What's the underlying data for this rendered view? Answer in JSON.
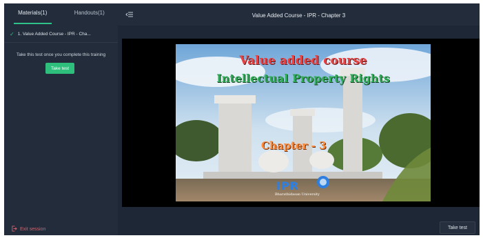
{
  "sidebar": {
    "tabs": [
      {
        "label": "Materials(1)",
        "active": true
      },
      {
        "label": "Handouts(1)",
        "active": false
      }
    ],
    "materials": [
      {
        "label": "1. Value Added Course - IPR - Cha...",
        "completed": true
      }
    ],
    "test_note": "Take this test once you complete this training",
    "take_test_label": "Take test",
    "exit_label": "Exit session"
  },
  "header": {
    "title": "Value Added Course - IPR - Chapter 3"
  },
  "slide": {
    "title_line1": "Value added course",
    "title_line2": "Intellectual Property Rights",
    "chapter": "Chapter - 3",
    "logo_text": "IPR",
    "logo_sub": "Bharathidasan University"
  },
  "footer": {
    "take_test_label": "Take test"
  },
  "colors": {
    "accent": "#2fbf7d",
    "panel": "#222c3b",
    "background": "#1d2736",
    "exit": "#d9606a"
  },
  "icons": {
    "check": "check-icon",
    "collapse": "collapse-sidebar-icon",
    "exit": "exit-icon"
  }
}
